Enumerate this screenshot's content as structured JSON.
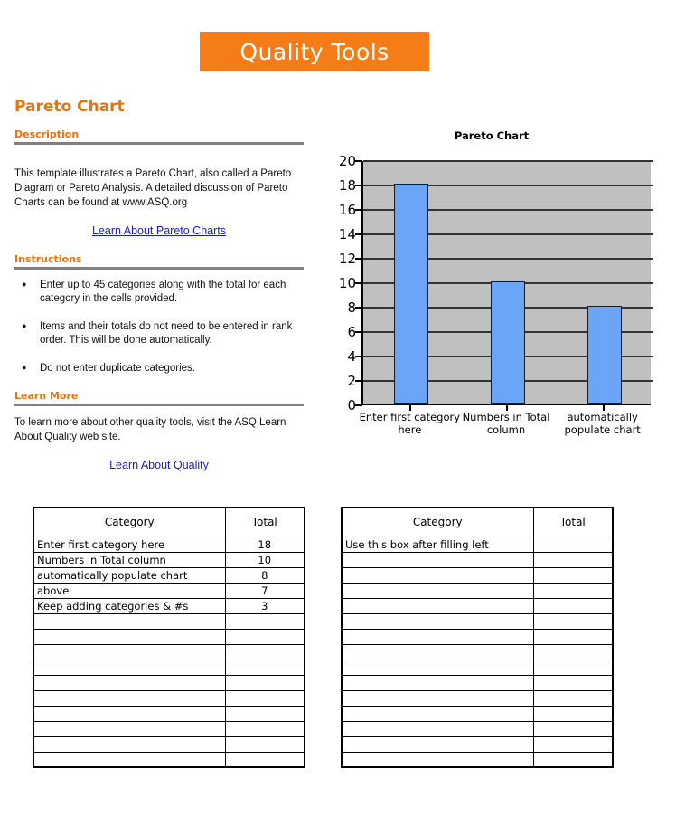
{
  "banner": {
    "title": "Quality Tools"
  },
  "page": {
    "title": "Pareto Chart"
  },
  "sections": {
    "description": {
      "heading": "Description",
      "body": "This template illustrates a Pareto Chart, also called a Pareto Diagram or Pareto Analysis.  A detailed discussion of Pareto Charts can be found at www.ASQ.org",
      "link": "Learn About Pareto Charts"
    },
    "instructions": {
      "heading": "Instructions",
      "bullets": [
        "Enter up to 45 categories along with the total for each category in the cells provided.",
        "Items and their totals do not need to be entered in rank order.  This will be done automatically.",
        "Do not enter duplicate categories."
      ]
    },
    "learn_more": {
      "heading": "Learn More",
      "body": "To learn more about other quality tools, visit the ASQ Learn About Quality web site.",
      "link": "Learn About Quality"
    }
  },
  "chart_data": {
    "type": "bar",
    "title": "Pareto Chart",
    "categories": [
      "Enter first category here",
      "Numbers in Total column",
      "automatically populate chart"
    ],
    "values": [
      18,
      10,
      8
    ],
    "xlabel": "",
    "ylabel": "",
    "ylim": [
      0,
      20
    ],
    "ytick_step": 2,
    "yticks": [
      20,
      18,
      16,
      14,
      12,
      10,
      8,
      6,
      4,
      2,
      0
    ],
    "grid": true,
    "legend": false,
    "plot_background": "#C0C0C0",
    "bar_color": "#6BA5F7"
  },
  "tables": {
    "left": {
      "headers": [
        "Category",
        "Total"
      ],
      "rows": [
        {
          "category": "Enter first category here",
          "total": "18"
        },
        {
          "category": "Numbers in Total column",
          "total": "10"
        },
        {
          "category": "automatically populate chart",
          "total": "8"
        },
        {
          "category": "above",
          "total": "7"
        },
        {
          "category": "Keep adding categories & #s",
          "total": "3"
        },
        {
          "category": "",
          "total": ""
        },
        {
          "category": "",
          "total": ""
        },
        {
          "category": "",
          "total": ""
        },
        {
          "category": "",
          "total": ""
        },
        {
          "category": "",
          "total": ""
        },
        {
          "category": "",
          "total": ""
        },
        {
          "category": "",
          "total": ""
        },
        {
          "category": "",
          "total": ""
        },
        {
          "category": "",
          "total": ""
        },
        {
          "category": "",
          "total": ""
        }
      ]
    },
    "right": {
      "headers": [
        "Category",
        "Total"
      ],
      "rows": [
        {
          "category": "Use this box after filling left",
          "total": ""
        },
        {
          "category": "",
          "total": ""
        },
        {
          "category": "",
          "total": ""
        },
        {
          "category": "",
          "total": ""
        },
        {
          "category": "",
          "total": ""
        },
        {
          "category": "",
          "total": ""
        },
        {
          "category": "",
          "total": ""
        },
        {
          "category": "",
          "total": ""
        },
        {
          "category": "",
          "total": ""
        },
        {
          "category": "",
          "total": ""
        },
        {
          "category": "",
          "total": ""
        },
        {
          "category": "",
          "total": ""
        },
        {
          "category": "",
          "total": ""
        },
        {
          "category": "",
          "total": ""
        },
        {
          "category": "",
          "total": ""
        }
      ]
    }
  },
  "colors": {
    "brand_orange": "#F57C16",
    "heading_orange": "#E8730B",
    "rule_gray": "#808080",
    "link_blue": "#1C1CC8"
  }
}
